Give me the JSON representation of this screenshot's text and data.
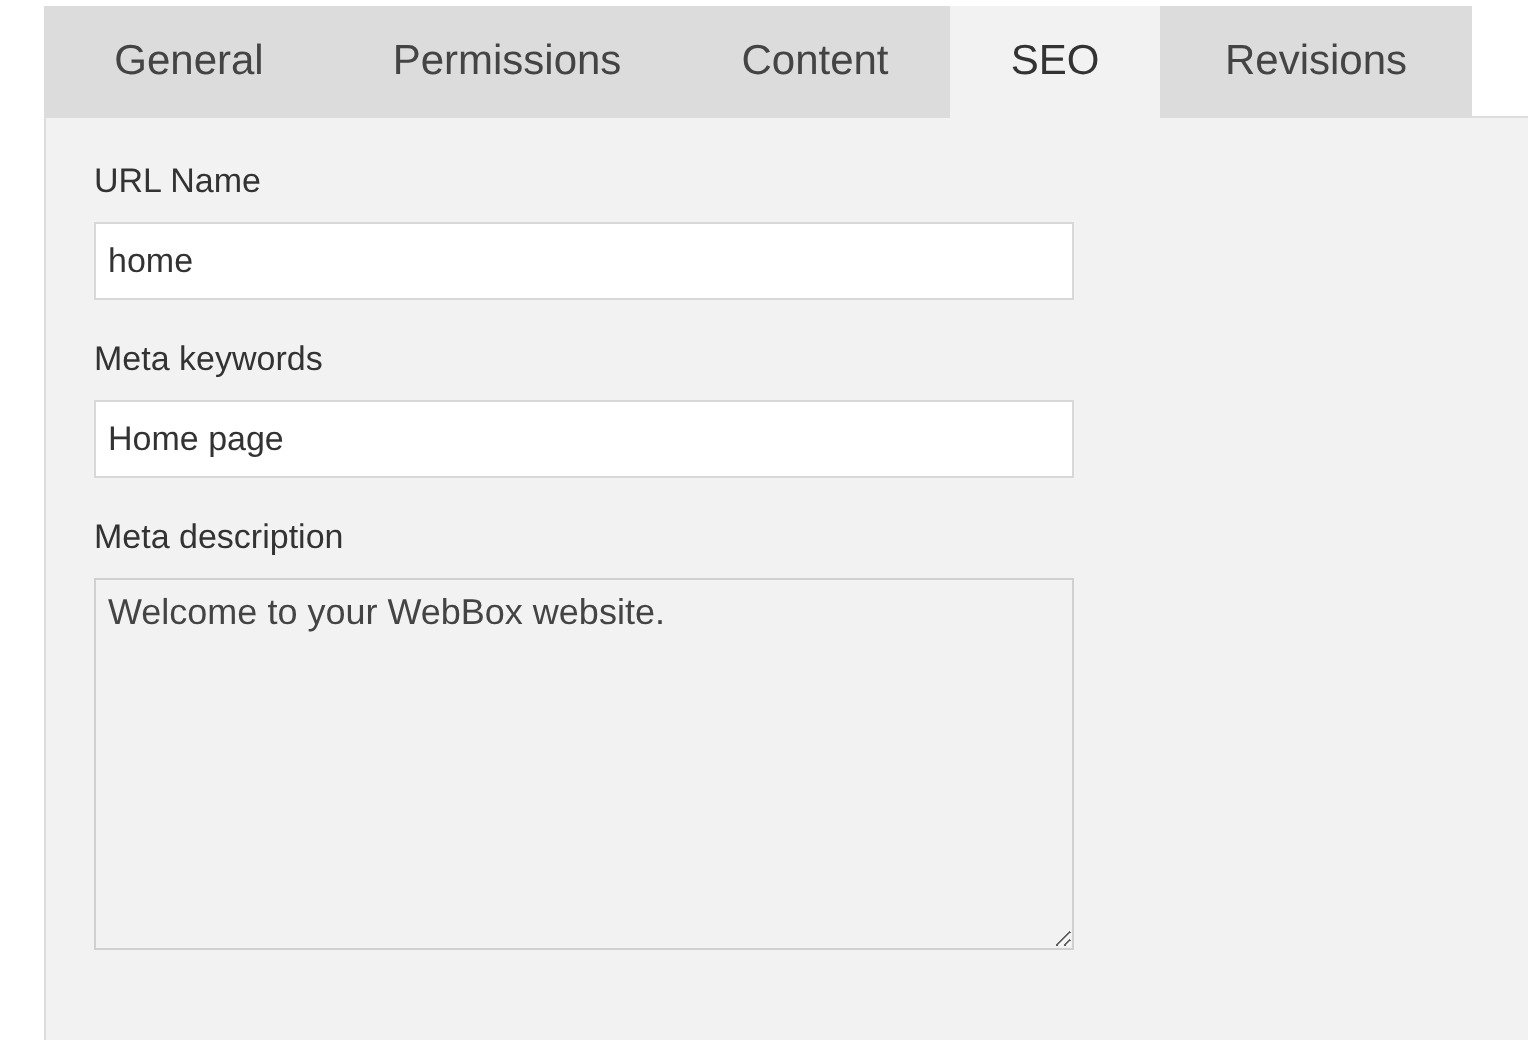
{
  "tabs": [
    {
      "label": "General",
      "selected": false
    },
    {
      "label": "Permissions",
      "selected": false
    },
    {
      "label": "Content",
      "selected": false
    },
    {
      "label": "SEO",
      "selected": true
    },
    {
      "label": "Revisions",
      "selected": false
    }
  ],
  "fields": [
    {
      "kind": "input",
      "label": "URL Name",
      "value": "home"
    },
    {
      "kind": "input",
      "label": "Meta keywords",
      "value": "Home page"
    },
    {
      "kind": "textarea",
      "label": "Meta description",
      "value": "Welcome to your WebBox website."
    }
  ]
}
